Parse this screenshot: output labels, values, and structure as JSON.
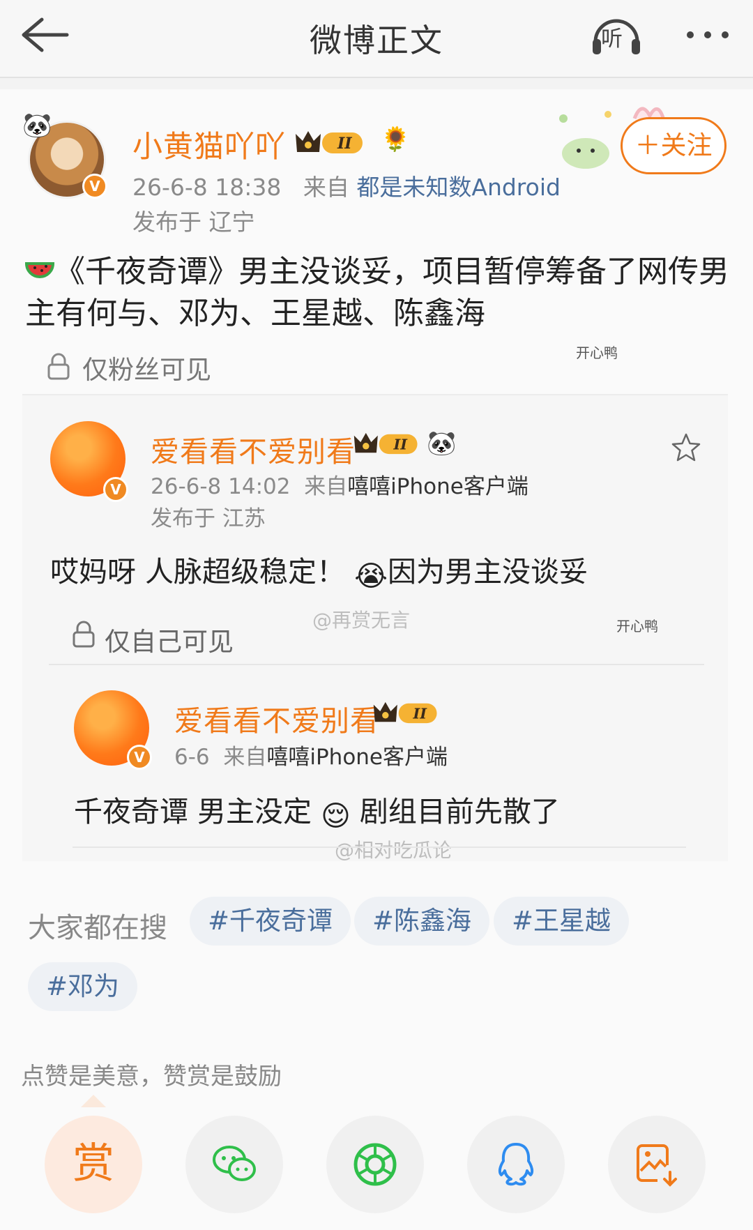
{
  "header": {
    "title": "微博正文",
    "listen_label": "听"
  },
  "post": {
    "author": "小黄猫吖吖",
    "time": "26-6-8 18:38",
    "source_prefix": "来自",
    "source": "都是未知数Android",
    "location": "发布于 辽宁",
    "follow_label": "＋关注",
    "text": "《千夜奇谭》男主没谈妥，项目暂停筹备了网传男主有何与、邓为、王星越、陈鑫海",
    "visibility": "仅粉丝可见",
    "sticker": "开心鸭"
  },
  "retweet1": {
    "author": "爱看看不爱别看",
    "time": "26-6-8 14:02",
    "source_prefix": "来自",
    "source": "嘻嘻iPhone客户端",
    "location": "发布于 江苏",
    "text_a": "哎妈呀 人脉超级稳定！",
    "text_b": "因为男主没谈妥",
    "visibility": "仅自己可见",
    "watermark": "@再赏无言",
    "sticker": "开心鸭"
  },
  "retweet2": {
    "author": "爱看看不爱别看",
    "time": "6-6",
    "source_prefix": "来自",
    "source": "嘻嘻iPhone客户端",
    "text_a": "千夜奇谭 男主没定",
    "text_b": "剧组目前先散了",
    "watermark": "@相对吃瓜论"
  },
  "hot": {
    "label": "大家都在搜",
    "tags": [
      "#千夜奇谭",
      "#陈鑫海",
      "#王星越",
      "#邓为"
    ]
  },
  "reward": {
    "caption": "点赞是美意，赞赏是鼓励",
    "button_label": "赏"
  },
  "badge": {
    "level": "II",
    "verified": "V"
  },
  "colors": {
    "accent": "#f07a1a",
    "link": "#4a6e9c",
    "wechat": "#2fbf4a",
    "qq": "#2e8cf0"
  },
  "icons": [
    "back-arrow-icon",
    "headphone-icon",
    "more-icon",
    "lock-icon",
    "star-icon",
    "wechat-icon",
    "moments-icon",
    "qq-icon",
    "save-image-icon"
  ]
}
